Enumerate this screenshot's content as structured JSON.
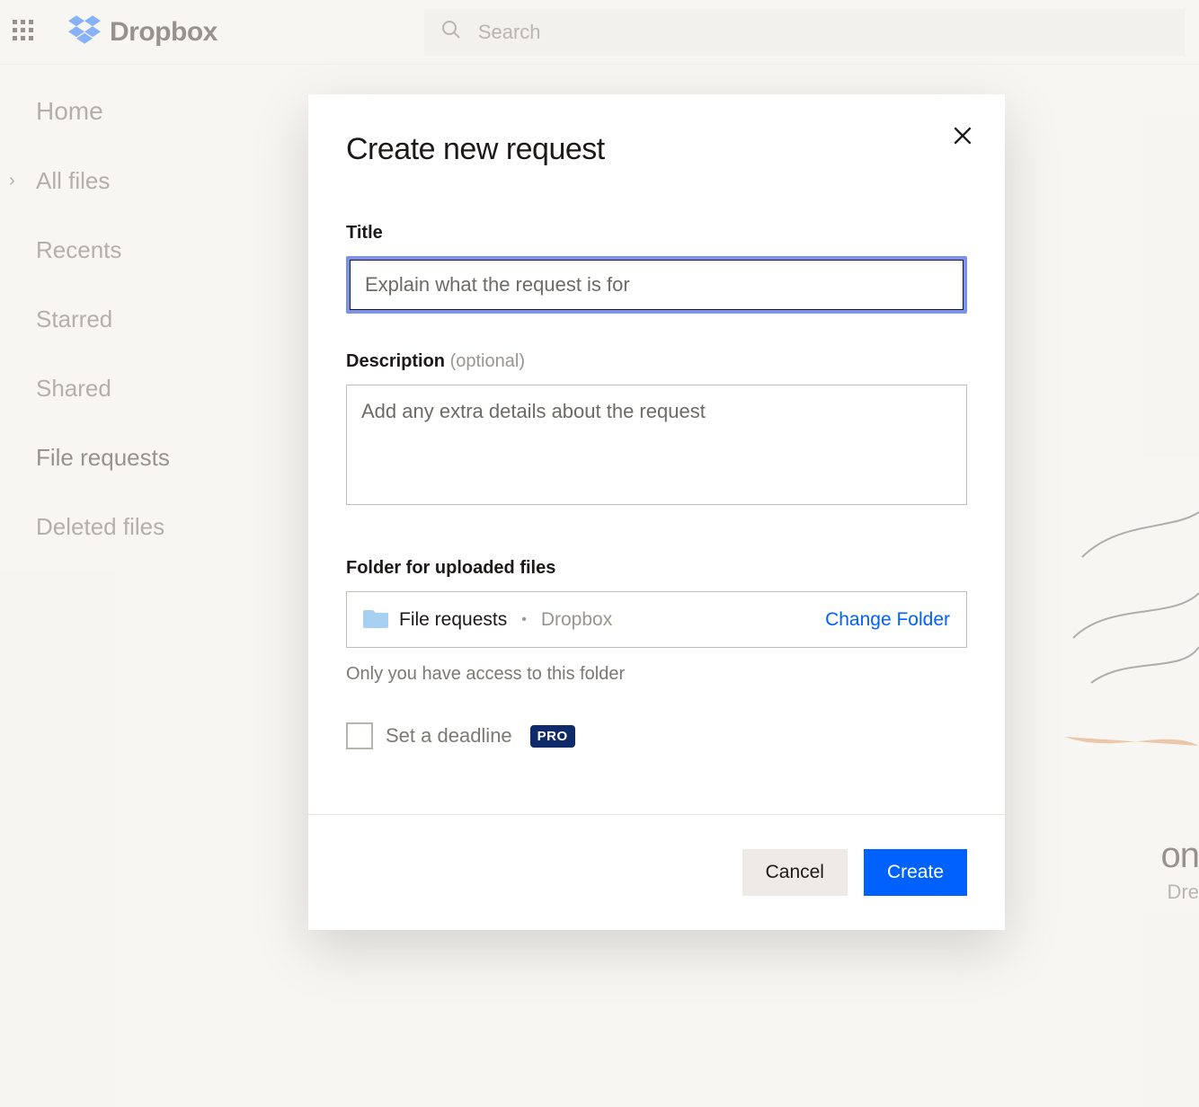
{
  "header": {
    "brand": "Dropbox",
    "search_placeholder": "Search"
  },
  "sidebar": {
    "items": [
      {
        "label": "Home"
      },
      {
        "label": "All files"
      },
      {
        "label": "Recents"
      },
      {
        "label": "Starred"
      },
      {
        "label": "Shared"
      },
      {
        "label": "File requests"
      },
      {
        "label": "Deleted files"
      }
    ]
  },
  "background": {
    "headline_fragment": "on",
    "sub_fragment": "Dre"
  },
  "modal": {
    "title": "Create new request",
    "fields": {
      "title_label": "Title",
      "title_placeholder": "Explain what the request is for",
      "desc_label": "Description",
      "desc_optional": "(optional)",
      "desc_placeholder": "Add any extra details about the request",
      "folder_label": "Folder for uploaded files",
      "folder_name": "File requests",
      "folder_path": "Dropbox",
      "change_folder": "Change Folder",
      "access_note": "Only you have access to this folder",
      "deadline_label": "Set a deadline",
      "pro_badge": "PRO"
    },
    "buttons": {
      "cancel": "Cancel",
      "create": "Create"
    }
  }
}
